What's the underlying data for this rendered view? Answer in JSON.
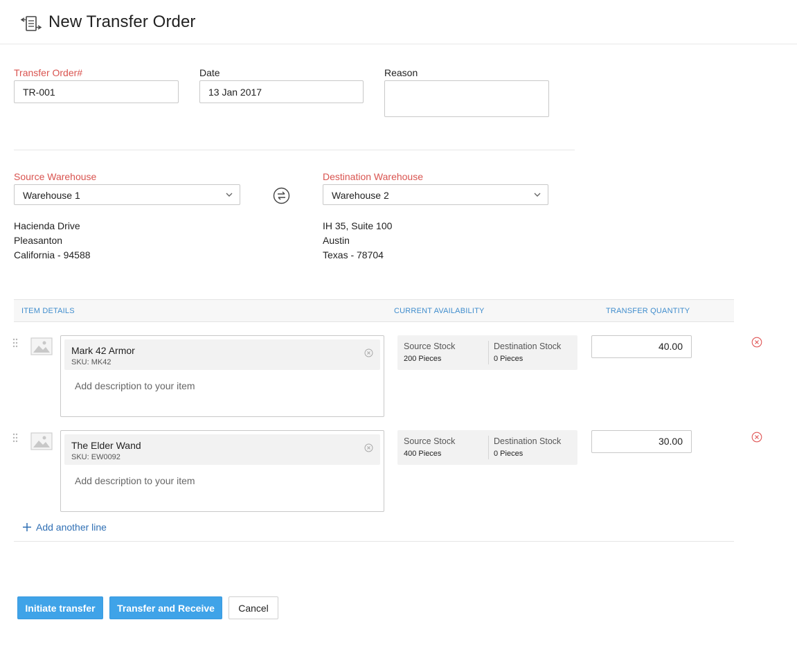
{
  "header": {
    "title": "New Transfer Order",
    "icon": "transfer-order-icon"
  },
  "form": {
    "transfer_order": {
      "label": "Transfer Order#",
      "value": "TR-001"
    },
    "date": {
      "label": "Date",
      "value": "13 Jan 2017"
    },
    "reason": {
      "label": "Reason",
      "value": ""
    }
  },
  "source": {
    "label": "Source Warehouse",
    "selected": "Warehouse 1",
    "address": [
      "Hacienda Drive",
      "Pleasanton",
      "California - 94588"
    ]
  },
  "destination": {
    "label": "Destination Warehouse",
    "selected": "Warehouse 2",
    "address": [
      "IH 35, Suite 100",
      "Austin",
      "Texas - 78704"
    ]
  },
  "table": {
    "headers": [
      "ITEM DETAILS",
      "CURRENT AVAILABILITY",
      "TRANSFER QUANTITY"
    ],
    "rows": [
      {
        "name": "Mark 42 Armor",
        "sku": "SKU: MK42",
        "description_placeholder": "Add description to your item",
        "source_stock_label": "Source Stock",
        "source_stock": "200 Pieces",
        "dest_stock_label": "Destination Stock",
        "dest_stock": "0 Pieces",
        "quantity": "40.00"
      },
      {
        "name": "The Elder Wand",
        "sku": "SKU: EW0092",
        "description_placeholder": "Add description to your item",
        "source_stock_label": "Source Stock",
        "source_stock": "400 Pieces",
        "dest_stock_label": "Destination Stock",
        "dest_stock": "0 Pieces",
        "quantity": "30.00"
      }
    ],
    "add_line_label": "Add another line"
  },
  "actions": {
    "initiate": "Initiate transfer",
    "transfer_receive": "Transfer and Receive",
    "cancel": "Cancel"
  },
  "colors": {
    "required_label": "#d9534f",
    "table_header_text": "#408dcd",
    "primary_button": "#3fa3e8",
    "link": "#2f6fb4",
    "remove_icon": "#e05555"
  }
}
